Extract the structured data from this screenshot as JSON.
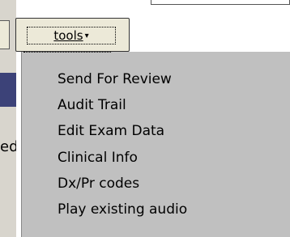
{
  "left_partial_text": "ed",
  "tools_button": {
    "label": "tools",
    "caret": "▾"
  },
  "menu": {
    "items": [
      {
        "label": "Send For Review"
      },
      {
        "label": "Audit Trail"
      },
      {
        "label": "Edit Exam Data"
      },
      {
        "label": "Clinical Info"
      },
      {
        "label": "Dx/Pr codes"
      },
      {
        "label": "Play existing audio"
      }
    ]
  },
  "colors": {
    "menu_background": "#c0c0c0",
    "button_face": "#ece9d8",
    "header_navy": "#3c4278"
  }
}
